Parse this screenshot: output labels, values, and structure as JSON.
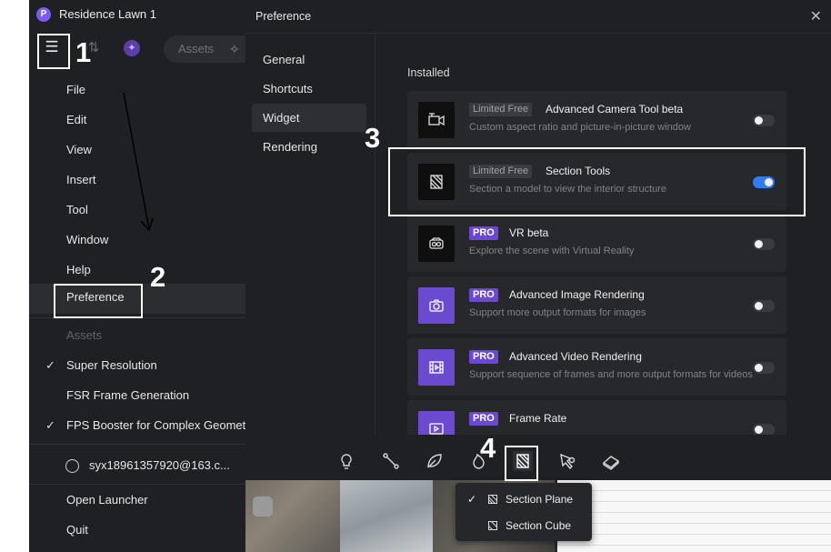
{
  "app": {
    "title": "Residence Lawn 1",
    "assets_label": "Assets"
  },
  "menu": {
    "items": [
      {
        "label": "File"
      },
      {
        "label": "Edit"
      },
      {
        "label": "View"
      },
      {
        "label": "Insert"
      },
      {
        "label": "Tool"
      },
      {
        "label": "Window"
      },
      {
        "label": "Help"
      },
      {
        "label": "Preference"
      }
    ],
    "assets_heading": "Assets",
    "options": [
      {
        "label": "Super Resolution",
        "checked": true
      },
      {
        "label": "FSR Frame Generation",
        "checked": false
      },
      {
        "label": "FPS Booster for Complex Geometry",
        "checked": true
      }
    ],
    "user": "syx18961357920@163.c...",
    "open_launcher": "Open Launcher",
    "quit": "Quit"
  },
  "preference": {
    "title": "Preference",
    "close": "✕",
    "nav": [
      "General",
      "Shortcuts",
      "Widget",
      "Rendering"
    ],
    "active_nav": "Widget",
    "installed_heading": "Installed",
    "widgets": [
      {
        "badge": "Limited Free",
        "badge_type": "free",
        "name": "Advanced Camera Tool beta",
        "desc": "Custom aspect ratio and picture-in-picture window",
        "enabled": false,
        "icon": "camera-crop-icon"
      },
      {
        "badge": "Limited Free",
        "badge_type": "free",
        "name": "Section Tools",
        "desc": "Section a model to view the interior structure",
        "enabled": true,
        "icon": "section-plane-icon"
      },
      {
        "badge": "PRO",
        "badge_type": "pro",
        "name": "VR beta",
        "desc": "Explore the scene with Virtual Reality",
        "enabled": false,
        "icon": "vr-headset-icon"
      },
      {
        "badge": "PRO",
        "badge_type": "pro",
        "name": "Advanced Image Rendering",
        "desc": "Support more output formats for images",
        "enabled": false,
        "icon": "camera-icon"
      },
      {
        "badge": "PRO",
        "badge_type": "pro",
        "name": "Advanced Video Rendering",
        "desc": "Support sequence of frames and more output formats for videos",
        "enabled": false,
        "icon": "film-icon"
      },
      {
        "badge": "PRO",
        "badge_type": "pro",
        "name": "Frame Rate",
        "desc": "",
        "enabled": false,
        "icon": "fps-icon"
      }
    ]
  },
  "bottom_toolbar": {
    "tools": [
      "light-bulb-icon",
      "path-icon",
      "leaf-icon",
      "fire-icon",
      "section-tool-icon",
      "pen-tool-icon",
      "eraser-icon"
    ],
    "active": "section-tool-icon"
  },
  "section_menu": {
    "items": [
      {
        "label": "Section Plane",
        "checked": true
      },
      {
        "label": "Section Cube",
        "checked": false
      }
    ]
  },
  "annotations": {
    "step1": "1",
    "step2": "2",
    "step3": "3",
    "step4": "4"
  },
  "colors": {
    "accent": "#2f7cf6",
    "pro": "#6b47d6",
    "panel": "#1f2023"
  }
}
